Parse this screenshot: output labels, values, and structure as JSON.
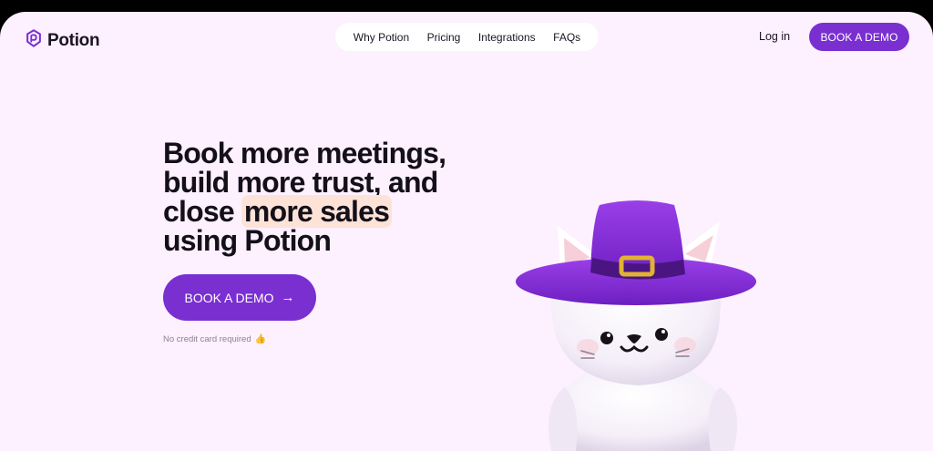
{
  "brand": {
    "name": "Potion",
    "logo_icon": "potion-logo-icon"
  },
  "nav": {
    "items": [
      {
        "label": "Why Potion"
      },
      {
        "label": "Pricing"
      },
      {
        "label": "Integrations"
      },
      {
        "label": "FAQs"
      }
    ]
  },
  "header": {
    "login_label": "Log in",
    "demo_label": "BOOK A DEMO"
  },
  "hero": {
    "headline_line1": "Book more meetings,",
    "headline_line2": "build more trust, and",
    "headline_line3_pre": "close ",
    "headline_line3_highlight": "more sales",
    "headline_line4": "using Potion",
    "cta_label": "BOOK A DEMO",
    "cta_icon": "arrow-right-icon",
    "note": "No credit card required",
    "note_icon": "thumbs-up-emoji"
  },
  "colors": {
    "accent": "#7a2fd1",
    "background": "#fdf0ff",
    "highlight": "#fde3d7",
    "text": "#14101a"
  },
  "illustration": {
    "icon": "cat-witch-hat-illustration"
  }
}
